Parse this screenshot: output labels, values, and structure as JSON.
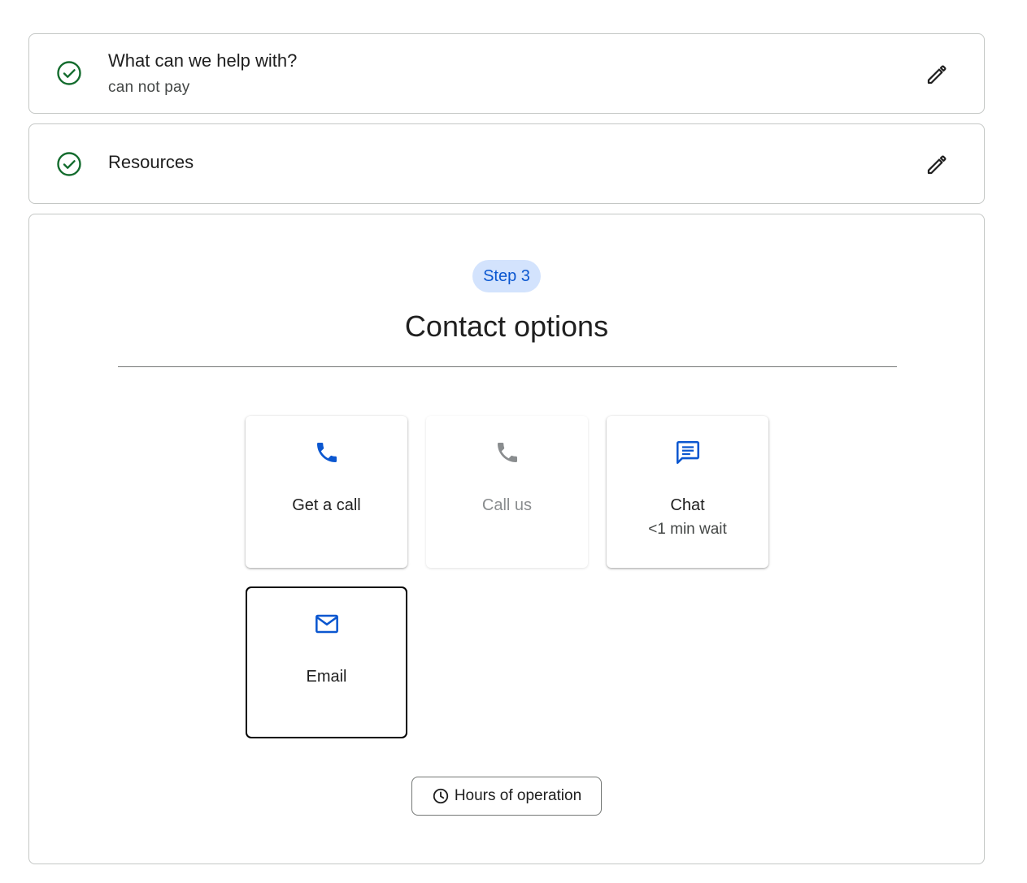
{
  "steps": {
    "step1": {
      "title": "What can we help with?",
      "answer": "can not pay",
      "status": "completed"
    },
    "step2": {
      "title": "Resources",
      "status": "completed"
    },
    "step3": {
      "chip": "Step 3",
      "title": "Contact options"
    }
  },
  "contact_options": [
    {
      "label": "Get a call",
      "icon": "phone-icon",
      "state": "enabled"
    },
    {
      "label": "Call us",
      "icon": "phone-icon",
      "state": "disabled"
    },
    {
      "label": "Chat",
      "sublabel": "<1 min wait",
      "icon": "chat-icon",
      "state": "enabled"
    },
    {
      "label": "Email",
      "icon": "mail-icon",
      "state": "selected"
    }
  ],
  "hours_button": {
    "label": "Hours of operation",
    "icon": "clock-icon"
  },
  "colors": {
    "check_green": "#146c2e",
    "accent_blue": "#0b57d0",
    "chip_bg": "#d3e3fd",
    "disabled_gray": "#8a8d8f"
  }
}
